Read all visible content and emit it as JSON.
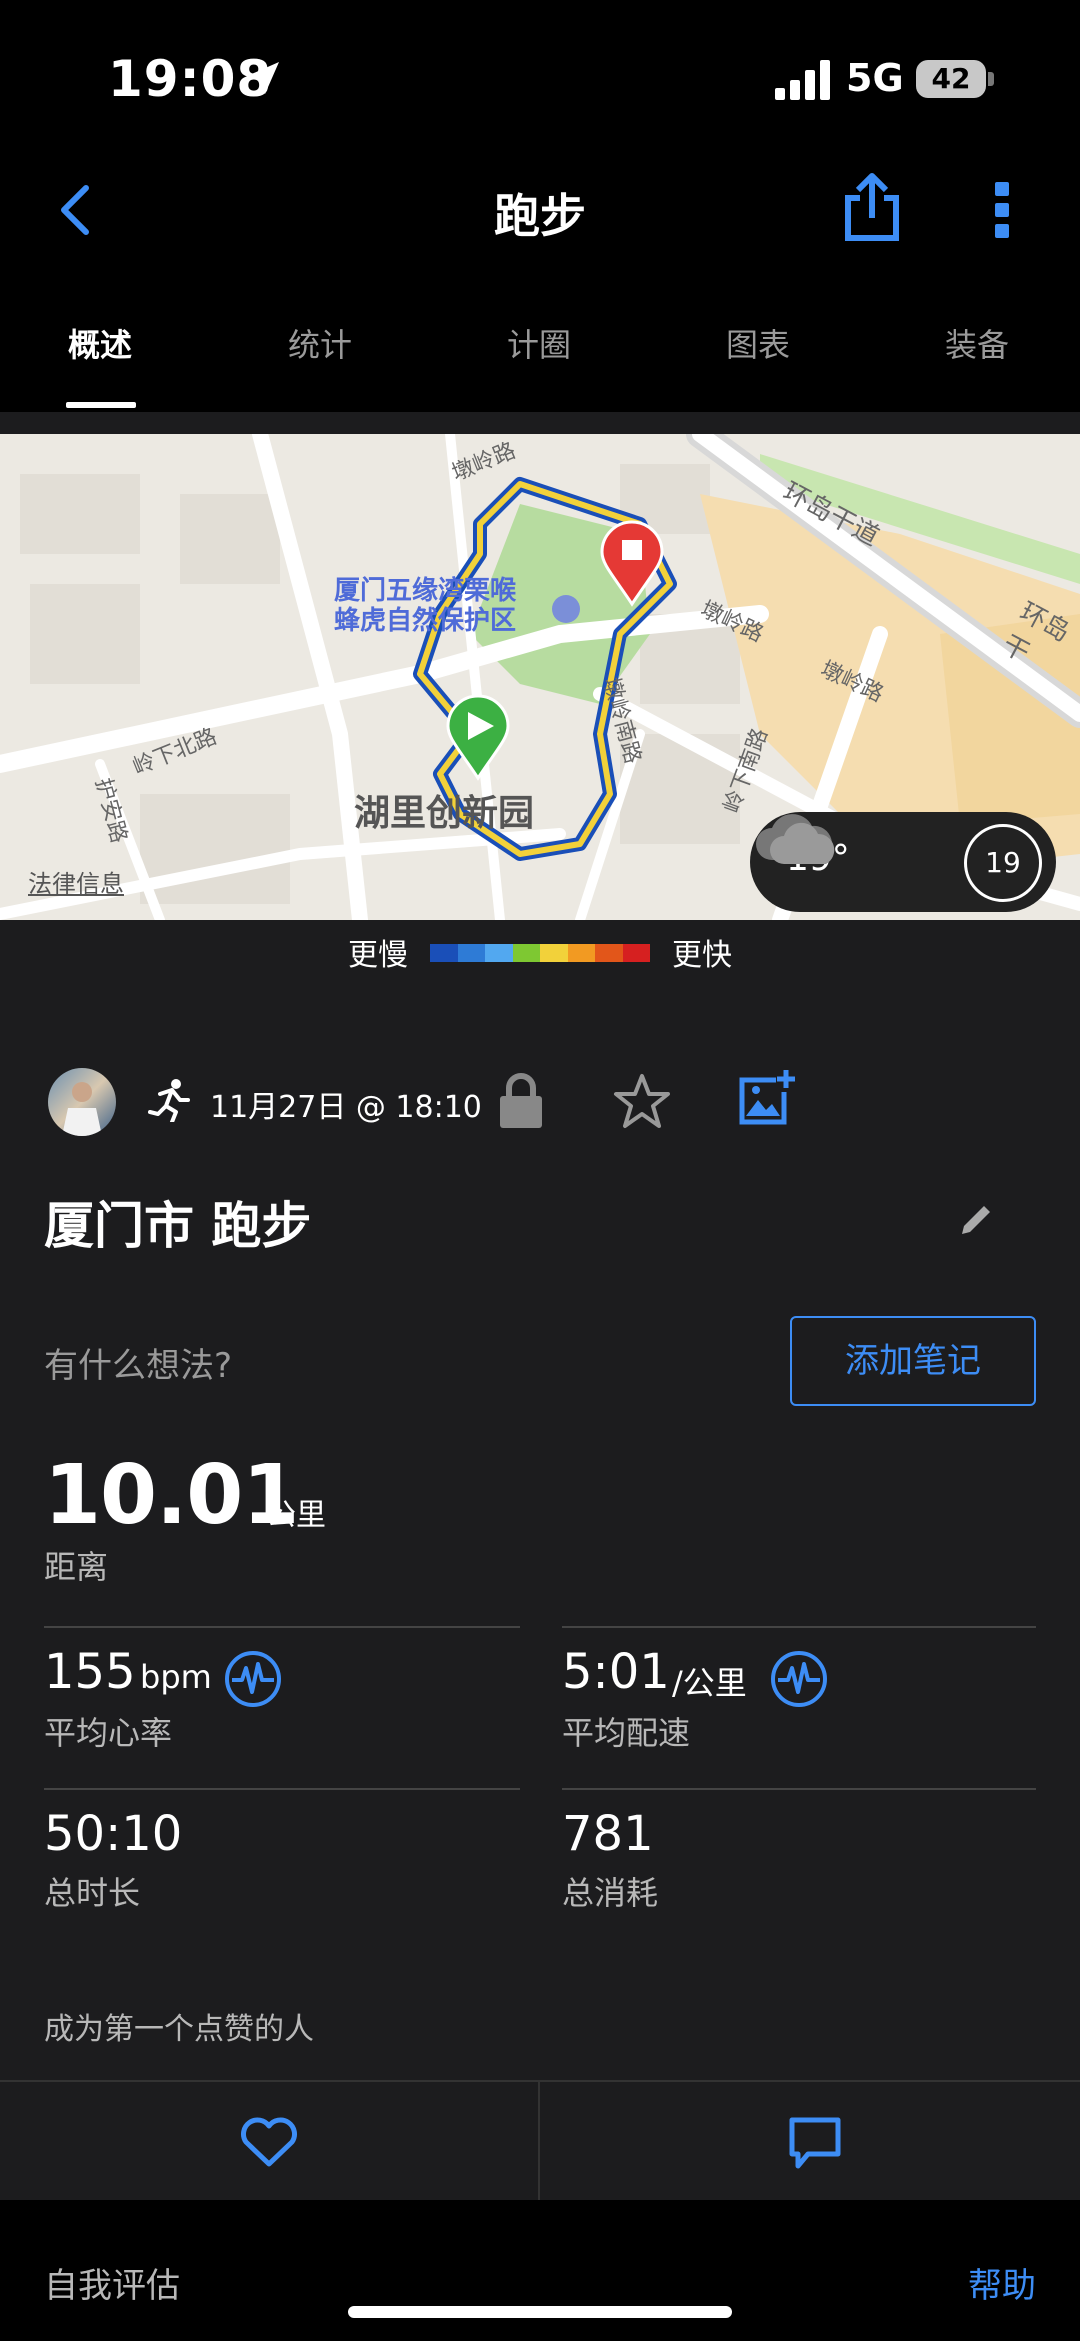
{
  "status_bar": {
    "time": "19:08",
    "network": "5G",
    "battery": "42"
  },
  "nav": {
    "title": "跑步",
    "icons": [
      "back-chevron-icon",
      "share-icon",
      "more-vertical-icon"
    ]
  },
  "tabs": [
    {
      "label": "概述",
      "active": true
    },
    {
      "label": "统计",
      "active": false
    },
    {
      "label": "计圈",
      "active": false
    },
    {
      "label": "图表",
      "active": false
    },
    {
      "label": "装备",
      "active": false
    }
  ],
  "map": {
    "poi_line1": "厦门五缘湾栗喉",
    "poi_line2": "蜂虎自然保护区",
    "area_name": "湖里创新园",
    "legal": "法律信息",
    "streets": [
      "墩岭路",
      "环岛干道",
      "环岛干",
      "岭下北路",
      "护安路",
      "墩岭路",
      "墩岭路",
      "墩岭南路",
      "岭下南路"
    ],
    "weather": {
      "temp": "19°",
      "wind": "19",
      "icon": "cloud-icon"
    }
  },
  "legend": {
    "slow": "更慢",
    "fast": "更快",
    "colors": [
      "#1a4fb8",
      "#2e7bd6",
      "#52a8f0",
      "#7ec832",
      "#f2d13a",
      "#f29a22",
      "#e2561a",
      "#d62020"
    ]
  },
  "activity": {
    "date": "11月27日 @ 18:10",
    "title": "厦门市 跑步",
    "thoughts_prompt": "有什么想法?",
    "add_note": "添加笔记"
  },
  "stats": {
    "distance": {
      "value": "10.01",
      "unit": "公里",
      "label": "距离"
    },
    "avg_hr": {
      "value": "155",
      "unit": "bpm",
      "label": "平均心率"
    },
    "avg_pace": {
      "value": "5:01",
      "unit": "/公里",
      "label": "平均配速"
    },
    "duration": {
      "value": "50:10",
      "label": "总时长"
    },
    "calories": {
      "value": "781",
      "label": "总消耗"
    }
  },
  "social": {
    "likes_text": "成为第一个点赞的人"
  },
  "footer": {
    "self_eval": "自我评估",
    "help": "帮助"
  },
  "colors": {
    "accent": "#3d8df5",
    "background": "#1c1c1e",
    "start_marker": "#3cb043",
    "end_marker": "#e53935"
  }
}
